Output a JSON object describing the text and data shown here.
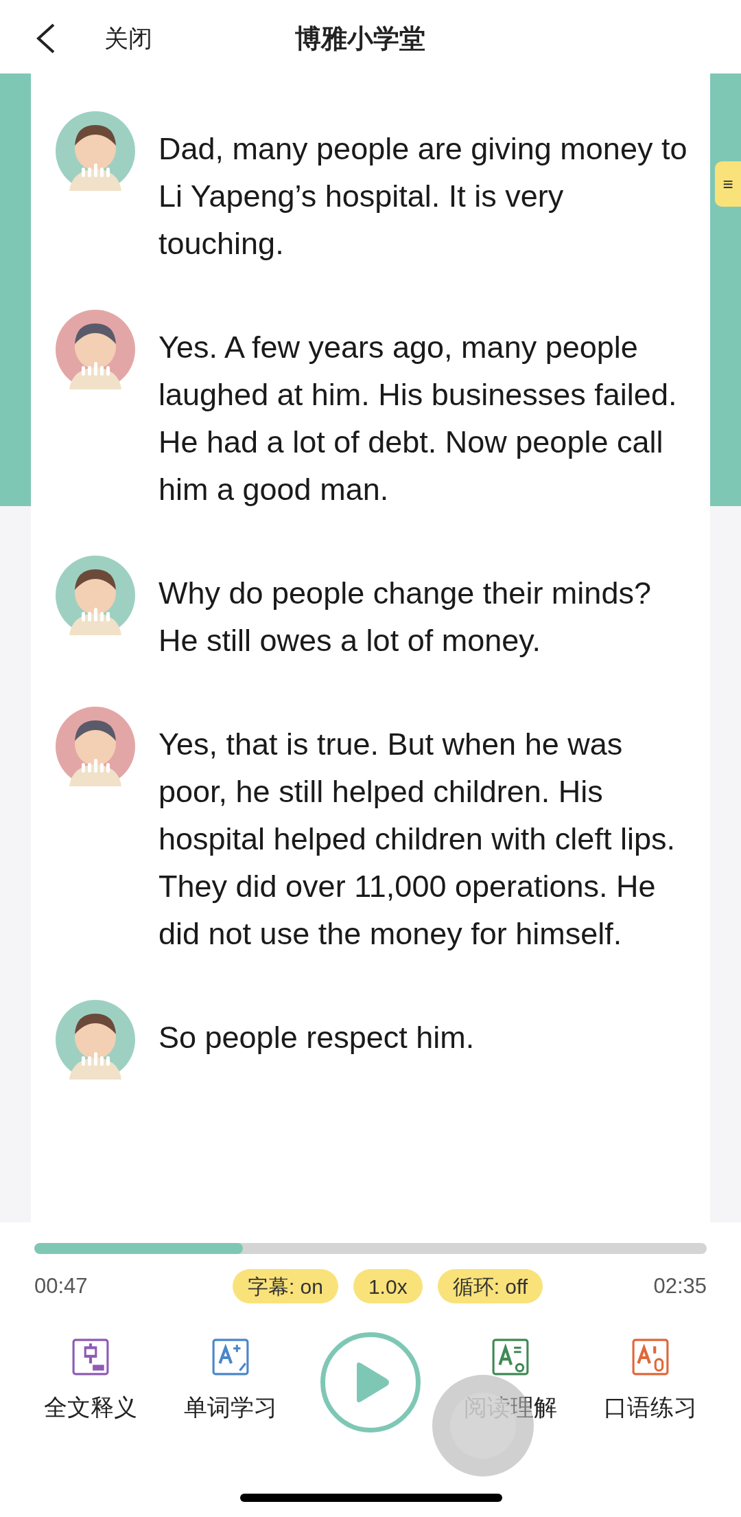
{
  "header": {
    "back": "关闭",
    "title": "博雅小学堂"
  },
  "messages": [
    {
      "kind": "child",
      "text": "Dad, many people are giving money to Li Yapeng’s hospital. It is very touching."
    },
    {
      "kind": "father",
      "text": "Yes. A few years ago, many people laughed at him. His businesses failed. He had a lot of debt. Now people call him a good man."
    },
    {
      "kind": "child",
      "text": "Why do people change their minds? He still owes a lot of money."
    },
    {
      "kind": "father",
      "text": "Yes, that is true. But when he was poor, he still helped children. His hospital helped children with cleft lips. They did over 11,000 operations. He did not use the money for himself."
    },
    {
      "kind": "child",
      "text": "So people respect him."
    }
  ],
  "side_tab": {
    "label": "≡"
  },
  "player": {
    "level": 0.31,
    "elapsed": "00:47",
    "total": "02:35",
    "chips": [
      {
        "label": "字幕: on"
      },
      {
        "label": "1.0x"
      },
      {
        "label": "循环: off"
      }
    ],
    "tools": [
      {
        "kind": "translate",
        "label": "全文释义"
      },
      {
        "kind": "words",
        "label": "单词学习"
      },
      {
        "kind": "reading",
        "label": "阅读理解"
      },
      {
        "kind": "speaking",
        "label": "口语练习"
      }
    ]
  }
}
